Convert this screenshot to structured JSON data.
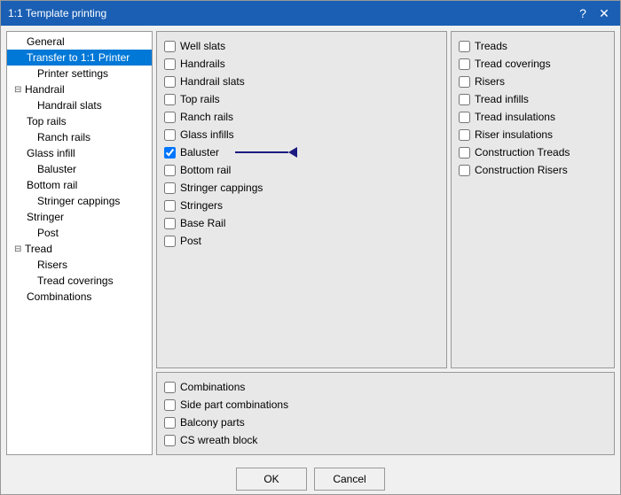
{
  "window": {
    "title": "1:1 Template printing",
    "help_label": "?",
    "close_label": "✕"
  },
  "tree": {
    "items": [
      {
        "id": "general",
        "label": "General",
        "indent": 0,
        "expand": false,
        "selected": false
      },
      {
        "id": "transfer",
        "label": "Transfer to 1:1 Printer",
        "indent": 0,
        "expand": false,
        "selected": true
      },
      {
        "id": "printer-settings",
        "label": "Printer settings",
        "indent": 1,
        "expand": false,
        "selected": false
      },
      {
        "id": "handrail",
        "label": "Handrail",
        "indent": 0,
        "expand": true,
        "selected": false
      },
      {
        "id": "handrail-slats",
        "label": "Handrail slats",
        "indent": 1,
        "expand": false,
        "selected": false
      },
      {
        "id": "top-rails",
        "label": "Top rails",
        "indent": 0,
        "expand": false,
        "selected": false
      },
      {
        "id": "ranch-rails",
        "label": "Ranch rails",
        "indent": 1,
        "expand": false,
        "selected": false
      },
      {
        "id": "glass-infill",
        "label": "Glass infill",
        "indent": 0,
        "expand": false,
        "selected": false
      },
      {
        "id": "baluster",
        "label": "Baluster",
        "indent": 1,
        "expand": false,
        "selected": false
      },
      {
        "id": "bottom-rail",
        "label": "Bottom rail",
        "indent": 0,
        "expand": false,
        "selected": false
      },
      {
        "id": "stringer-cappings",
        "label": "Stringer cappings",
        "indent": 1,
        "expand": false,
        "selected": false
      },
      {
        "id": "stringer",
        "label": "Stringer",
        "indent": 0,
        "expand": false,
        "selected": false
      },
      {
        "id": "post",
        "label": "Post",
        "indent": 1,
        "expand": false,
        "selected": false
      },
      {
        "id": "tread",
        "label": "Tread",
        "indent": 0,
        "expand": true,
        "selected": false
      },
      {
        "id": "risers",
        "label": "Risers",
        "indent": 1,
        "expand": false,
        "selected": false
      },
      {
        "id": "tread-coverings",
        "label": "Tread coverings",
        "indent": 1,
        "expand": false,
        "selected": false
      },
      {
        "id": "combinations",
        "label": "Combinations",
        "indent": 0,
        "expand": false,
        "selected": false
      }
    ]
  },
  "left_checkboxes": [
    {
      "id": "well-slats",
      "label": "Well slats",
      "checked": false
    },
    {
      "id": "handrails",
      "label": "Handrails",
      "checked": false
    },
    {
      "id": "handrail-slats",
      "label": "Handrail slats",
      "checked": false
    },
    {
      "id": "top-rails",
      "label": "Top rails",
      "checked": false
    },
    {
      "id": "ranch-rails",
      "label": "Ranch rails",
      "checked": false
    },
    {
      "id": "glass-infills",
      "label": "Glass infills",
      "checked": false
    },
    {
      "id": "baluster",
      "label": "Baluster",
      "checked": true
    },
    {
      "id": "bottom-rail",
      "label": "Bottom rail",
      "checked": false
    },
    {
      "id": "stringer-cappings",
      "label": "Stringer cappings",
      "checked": false
    },
    {
      "id": "stringers",
      "label": "Stringers",
      "checked": false
    },
    {
      "id": "base-rail",
      "label": "Base Rail",
      "checked": false
    },
    {
      "id": "post",
      "label": "Post",
      "checked": false
    }
  ],
  "right_checkboxes": [
    {
      "id": "treads",
      "label": "Treads",
      "checked": false
    },
    {
      "id": "tread-coverings",
      "label": "Tread coverings",
      "checked": false
    },
    {
      "id": "risers",
      "label": "Risers",
      "checked": false
    },
    {
      "id": "tread-infills",
      "label": "Tread infills",
      "checked": false
    },
    {
      "id": "tread-insulations",
      "label": "Tread insulations",
      "checked": false
    },
    {
      "id": "riser-insulations",
      "label": "Riser insulations",
      "checked": false
    },
    {
      "id": "construction-treads",
      "label": "Construction Treads",
      "checked": false
    },
    {
      "id": "construction-risers",
      "label": "Construction Risers",
      "checked": false
    }
  ],
  "bottom_checkboxes": [
    {
      "id": "combinations",
      "label": "Combinations",
      "checked": false
    },
    {
      "id": "side-part-combinations",
      "label": "Side part combinations",
      "checked": false
    },
    {
      "id": "balcony-parts",
      "label": "Balcony parts",
      "checked": false
    },
    {
      "id": "cs-wreath-block",
      "label": "CS wreath block",
      "checked": false
    }
  ],
  "buttons": {
    "ok": "OK",
    "cancel": "Cancel"
  }
}
